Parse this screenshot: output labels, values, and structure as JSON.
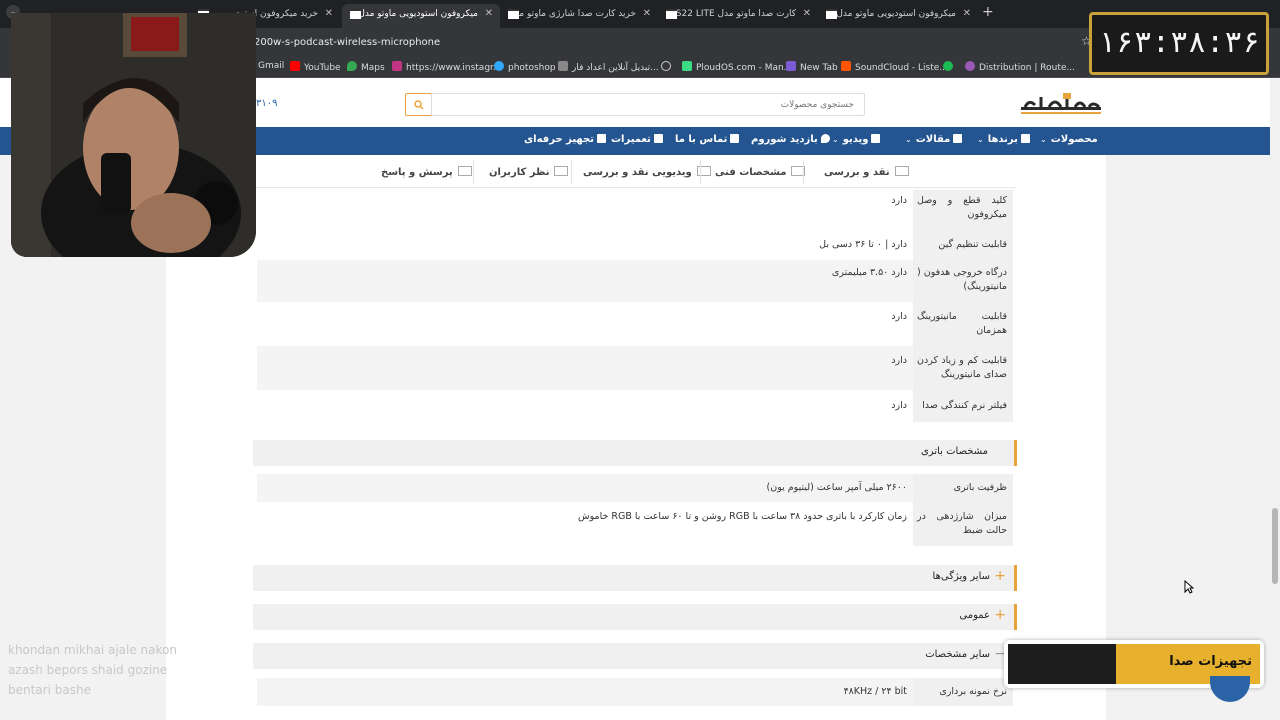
{
  "browser": {
    "tabs": [
      {
        "title": "خرید میکروفون استودیو"
      },
      {
        "title": "میکروفون استودیویی ماوتو مدل",
        "active": true
      },
      {
        "title": "خرید کارت صدا شارژی ماوتو مدل"
      },
      {
        "title": "کارت صدا ماوتو مدل PS22 LITE"
      },
      {
        "title": "میکروفون استودیویی ماوتو مدل"
      }
    ],
    "url": "200w-s-podcast-wireless-microphone",
    "bookmarks": [
      {
        "label": "Gmail",
        "color": "#ea4335"
      },
      {
        "label": "YouTube",
        "color": "#ff0000"
      },
      {
        "label": "Maps",
        "color": "#34a853"
      },
      {
        "label": "https://www.instagr...",
        "color": "#c13584"
      },
      {
        "label": "photoshop",
        "color": "#31a8ff"
      },
      {
        "label": "تبدیل آنلاین اعداد فار...",
        "color": "#888888"
      },
      {
        "label": "PloudOS.com - Man...",
        "color": "#3ddc84"
      },
      {
        "label": "New Tab",
        "color": "#7b5cd6"
      },
      {
        "label": "SoundCloud - Liste...",
        "color": "#ff5500"
      },
      {
        "label": "",
        "color": "#1db954"
      },
      {
        "label": "Distribution | Route...",
        "color": "#9b59b6"
      }
    ]
  },
  "site": {
    "search_placeholder": "جستجوی محصولات",
    "phone": "۳۱۰۹",
    "nav": [
      {
        "label": "محصولات",
        "has_dropdown": true
      },
      {
        "label": "برندها",
        "has_dropdown": true
      },
      {
        "label": "مقالات",
        "has_dropdown": true
      },
      {
        "label": "ویدیو",
        "has_dropdown": true
      },
      {
        "label": "بازدید شوروم"
      },
      {
        "label": "تماس با ما"
      },
      {
        "label": "تعمیرات"
      },
      {
        "label": "تجهیز حرفه‌ای"
      }
    ],
    "spec_tabs": [
      "نقد و بررسی",
      "مشخصات فنی",
      "ویدیویی نقد و بررسی",
      "نظر کاربران",
      "پرسش و پاسخ"
    ]
  },
  "specs": {
    "rows_top": [
      {
        "label": "کلید قطع و وصل میکروفون",
        "value": "دارد"
      },
      {
        "label": "قابلیت تنظیم گین",
        "value": "دارد | ۰ تا ۳۶ دسی بل"
      },
      {
        "label": "درگاه خروجی هدفون ( مانیتورینگ)",
        "value": "دارد ۳.۵۰ میلیمتری"
      },
      {
        "label": "قابلیت مانیتورینگ همزمان",
        "value": "دارد"
      },
      {
        "label": "قابلیت کم و زیاد کردن صدای مانیتورینگ",
        "value": "دارد"
      },
      {
        "label": "فیلتر نرم کنندگی صدا",
        "value": "دارد"
      }
    ],
    "battery_section": "مشخصات باتری",
    "battery_rows": [
      {
        "label": "ظرفیت باتری",
        "value": "۲۶۰۰ میلی آمپر ساعت (لیتیوم یون)"
      },
      {
        "label": "میزان شارژدهی در حالت ضبط",
        "value": "زمان کارکرد با باتری حدود ۳۸ ساعت با RGB روشن و تا ۶۰ ساعت با RGB خاموش"
      }
    ],
    "collapsed_sections": [
      "سایر ویژگی‌ها",
      "عمومی"
    ],
    "other_section": "سایر مشخصات",
    "other_rows": [
      {
        "label": "نرخ نمونه برداری",
        "value": "۴۸KHz / ۲۴ bit"
      }
    ]
  },
  "overlay": {
    "timer": "۱۶۳:۳۸:۳۶",
    "chat_lines": [
      "khondan mikhai ajale nakon",
      "azash bepors shaid gozine",
      "bentari bashe"
    ],
    "banner_text": "تجهیزات صدا"
  },
  "colors": {
    "accent": "#e8a33d",
    "nav": "#245590",
    "timer_border": "#c9a23a",
    "banner": "#e7b12d"
  }
}
